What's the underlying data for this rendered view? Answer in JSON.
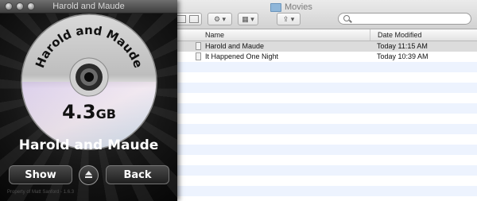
{
  "finder": {
    "title": "Movies",
    "columns": {
      "name": "Name",
      "date_modified": "Date Modified"
    },
    "files": [
      {
        "name": "Harold and Maude",
        "date": "Today 11:15 AM",
        "selected": true
      },
      {
        "name": "It Happened One Night",
        "date": "Today 10:39 AM",
        "selected": false
      }
    ],
    "icons": {
      "folder": "folder-icon",
      "search": "search-icon",
      "view_toggle": "view-toggle-icon",
      "action": "gear-icon",
      "arrange": "arrange-icon",
      "share": "share-icon"
    }
  },
  "app": {
    "title": "Harold and Maude",
    "disc": {
      "label": "Harold and Maude",
      "size_value": "4.3",
      "size_unit": "GB"
    },
    "movie_title": "Harold and Maude",
    "buttons": {
      "show": "Show",
      "back": "Back",
      "eject": "eject-icon"
    },
    "footer": "Property of Matt Sanford - 1.6.3"
  },
  "colors": {
    "selection": "#dcdcdc",
    "stripe": "#edf3fe",
    "app_bg": "#111111"
  }
}
